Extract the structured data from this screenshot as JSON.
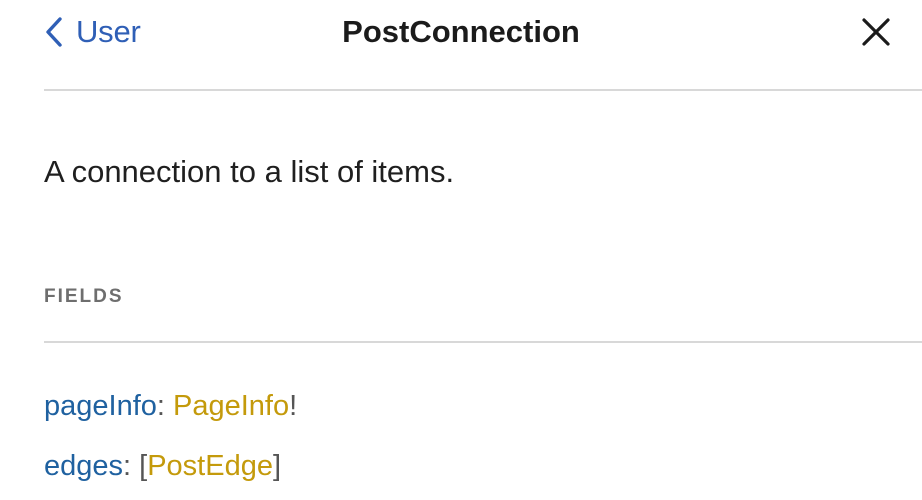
{
  "header": {
    "back_label": "User",
    "title": "PostConnection",
    "back_icon": "chevron-left-icon",
    "close_icon": "close-icon"
  },
  "description": "A connection to a list of items.",
  "fields_section": {
    "label": "FIELDS",
    "fields": [
      {
        "name": "pageInfo",
        "colon": ":",
        "open": "",
        "type": "PageInfo",
        "close": "!"
      },
      {
        "name": "edges",
        "colon": ":",
        "open": "[",
        "type": "PostEdge",
        "close": "]"
      }
    ]
  },
  "colors": {
    "link_blue": "#2f5fb6",
    "field_name": "#1f61a0",
    "type_gold": "#c49a0b",
    "section_label": "#6e6e6e",
    "divider": "#d8d8d8"
  }
}
